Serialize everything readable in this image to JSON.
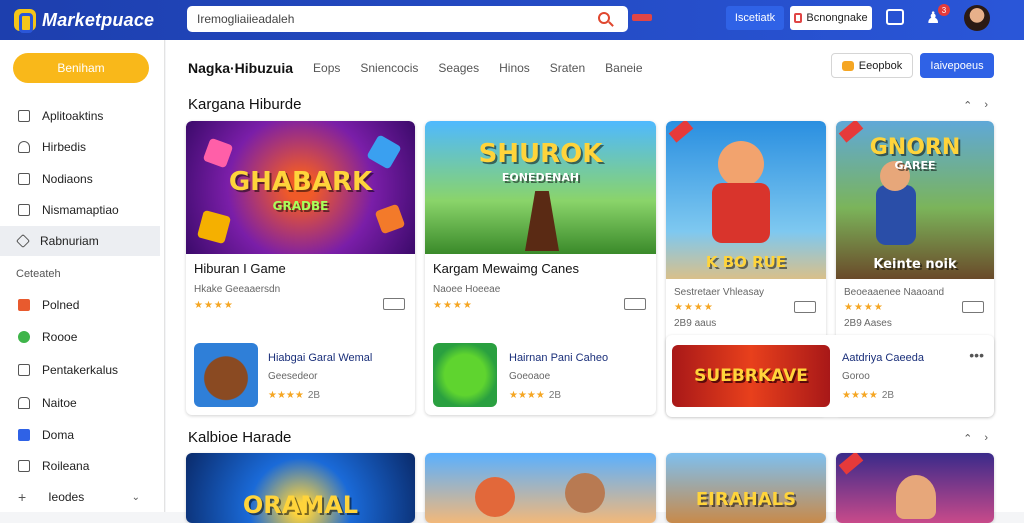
{
  "app": {
    "logo_text": "Marketpuace"
  },
  "search": {
    "value": "Iremogliaiieadaleh"
  },
  "topbar": {
    "btn1": "Iscetiatk",
    "btn2": "Bcnongnake",
    "badge": "3"
  },
  "sidebar": {
    "browse": "Beniham",
    "items": [
      {
        "label": "Aplitoaktins",
        "icon": "app-icon"
      },
      {
        "label": "Hirbedis",
        "icon": "user-icon"
      },
      {
        "label": "Nodiaons",
        "icon": "grid-icon"
      },
      {
        "label": "Nismamaptiao",
        "icon": "square-icon"
      },
      {
        "label": "Rabnuriam",
        "icon": "home-icon"
      }
    ],
    "section": "Ceteateh",
    "items2": [
      {
        "label": "Polned",
        "icon": "red-square-icon"
      },
      {
        "label": "Roooe",
        "icon": "green-ghost-icon"
      },
      {
        "label": "Pentakerkalus",
        "icon": "list-icon"
      },
      {
        "label": "Naitoe",
        "icon": "house-icon"
      },
      {
        "label": "Doma",
        "icon": "blue-page-icon"
      },
      {
        "label": "Roileana",
        "icon": "doc-icon"
      },
      {
        "label": "Ieodes",
        "icon": "plus-icon"
      }
    ]
  },
  "main": {
    "tabs": [
      "Nagka·Hibuzuia",
      "Eops",
      "Sniencocis",
      "Seages",
      "Hinos",
      "Sraten",
      "Baneie"
    ],
    "btn_a": "Eeopbok",
    "btn_b": "Iaivepoeus",
    "section1": "Kargana Hiburde",
    "section2": "Kalbioe Harade",
    "cards": [
      {
        "art": "GHABARK",
        "sub_art": "GRADBE",
        "name": "Hiburan I Game",
        "sub": "Hkake   Geeaaersdn",
        "stars": "★★★★"
      },
      {
        "art": "SHUROK",
        "sub_art": "EONEDENAH",
        "name": "Kargam Mewaimg Canes",
        "sub": "Naoee   Hoeeae",
        "stars": "★★★★"
      },
      {
        "art": "K BO RUE",
        "name": "Sestretaer   Vhleasay",
        "sub": "2B9 aaus",
        "stars": "★★★★"
      },
      {
        "art": "GNORN",
        "sub_art": "GAREE",
        "caption": "Keinte noik",
        "name": "Beoeaaenee Naaoand",
        "sub": "2B9 Aases",
        "stars": "★★★★"
      }
    ],
    "small_cards": [
      {
        "name": "Hiabgai Garal Wemal",
        "sub": "Geesedeor",
        "stars": "★★★★",
        "count": "2B"
      },
      {
        "name": "Hairnan Pani Caheo",
        "sub": "Goeoaoe",
        "stars": "★★★★",
        "count": "2B"
      },
      {
        "art": "SUEBRKAVE",
        "name": "Aatdriya Caeeda",
        "sub": "Goroo",
        "stars": "★★★★",
        "count": "2B"
      }
    ],
    "row2": [
      {
        "art": "ORAMAL"
      },
      {
        "art": ""
      },
      {
        "art": "EIRAHALS"
      },
      {
        "art": ""
      }
    ]
  }
}
